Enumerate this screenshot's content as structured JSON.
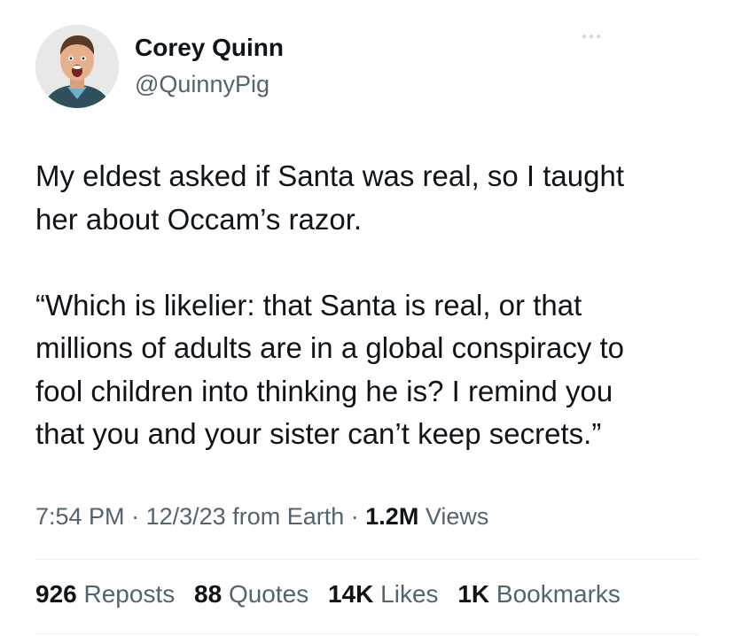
{
  "author": {
    "name": "Corey Quinn",
    "handle": "@QuinnyPig"
  },
  "tweet": {
    "paragraph_1": "My eldest asked if Santa was real, so I taught\nher about Occam’s razor.",
    "paragraph_2": "“Which is likelier: that Santa is real, or that\nmillions of adults are in a global conspiracy to\nfool children into thinking he is? I remind you\nthat you and your sister can’t keep secrets.”"
  },
  "meta": {
    "time": "7:54 PM",
    "separator": "·",
    "date": "12/3/23",
    "source": "from Earth",
    "views_count": "1.2M",
    "views_label": "Views"
  },
  "stats": {
    "reposts_count": "926",
    "reposts_label": "Reposts",
    "quotes_count": "88",
    "quotes_label": "Quotes",
    "likes_count": "14K",
    "likes_label": "Likes",
    "bookmarks_count": "1K",
    "bookmarks_label": "Bookmarks"
  },
  "colors": {
    "primary_text": "#0f1419",
    "secondary_text": "#536471",
    "divider": "#eff3f4"
  }
}
